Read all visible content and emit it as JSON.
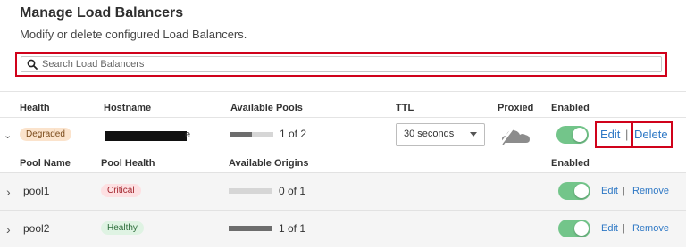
{
  "page": {
    "title": "Manage Load Balancers",
    "subtitle": "Modify or delete configured Load Balancers."
  },
  "search": {
    "placeholder": "Search Load Balancers",
    "value": ""
  },
  "table": {
    "headers": {
      "health": "Health",
      "hostname": "Hostname",
      "available_pools": "Available Pools",
      "ttl": "TTL",
      "proxied": "Proxied",
      "enabled": "Enabled"
    },
    "load_balancer": {
      "health": "Degraded",
      "hostname_visible_suffix": "e",
      "pools_available": 1,
      "pools_total": 2,
      "pools_text": "1 of 2",
      "ttl": "30 seconds",
      "proxied_icon": "cloud-off-icon",
      "enabled": true,
      "edit_label": "Edit",
      "separator": "|",
      "delete_label": "Delete"
    },
    "pool_headers": {
      "pool_name": "Pool Name",
      "pool_health": "Pool Health",
      "available_origins": "Available Origins",
      "enabled": "Enabled"
    },
    "pools": [
      {
        "name": "pool1",
        "health": "Critical",
        "origins_available": 0,
        "origins_total": 1,
        "origins_text": "0 of 1",
        "enabled": true,
        "edit_label": "Edit",
        "separator": "|",
        "remove_label": "Remove"
      },
      {
        "name": "pool2",
        "health": "Healthy",
        "origins_available": 1,
        "origins_total": 1,
        "origins_text": "1 of 1",
        "enabled": true,
        "edit_label": "Edit",
        "separator": "|",
        "remove_label": "Remove"
      }
    ]
  },
  "colors": {
    "accent_link": "#2e78c5",
    "toggle_on": "#73c58a",
    "highlight_box": "#d0021b",
    "degraded_badge": "#fbe3cc",
    "critical_badge": "#fde0e2",
    "healthy_badge": "#dff3e3"
  }
}
